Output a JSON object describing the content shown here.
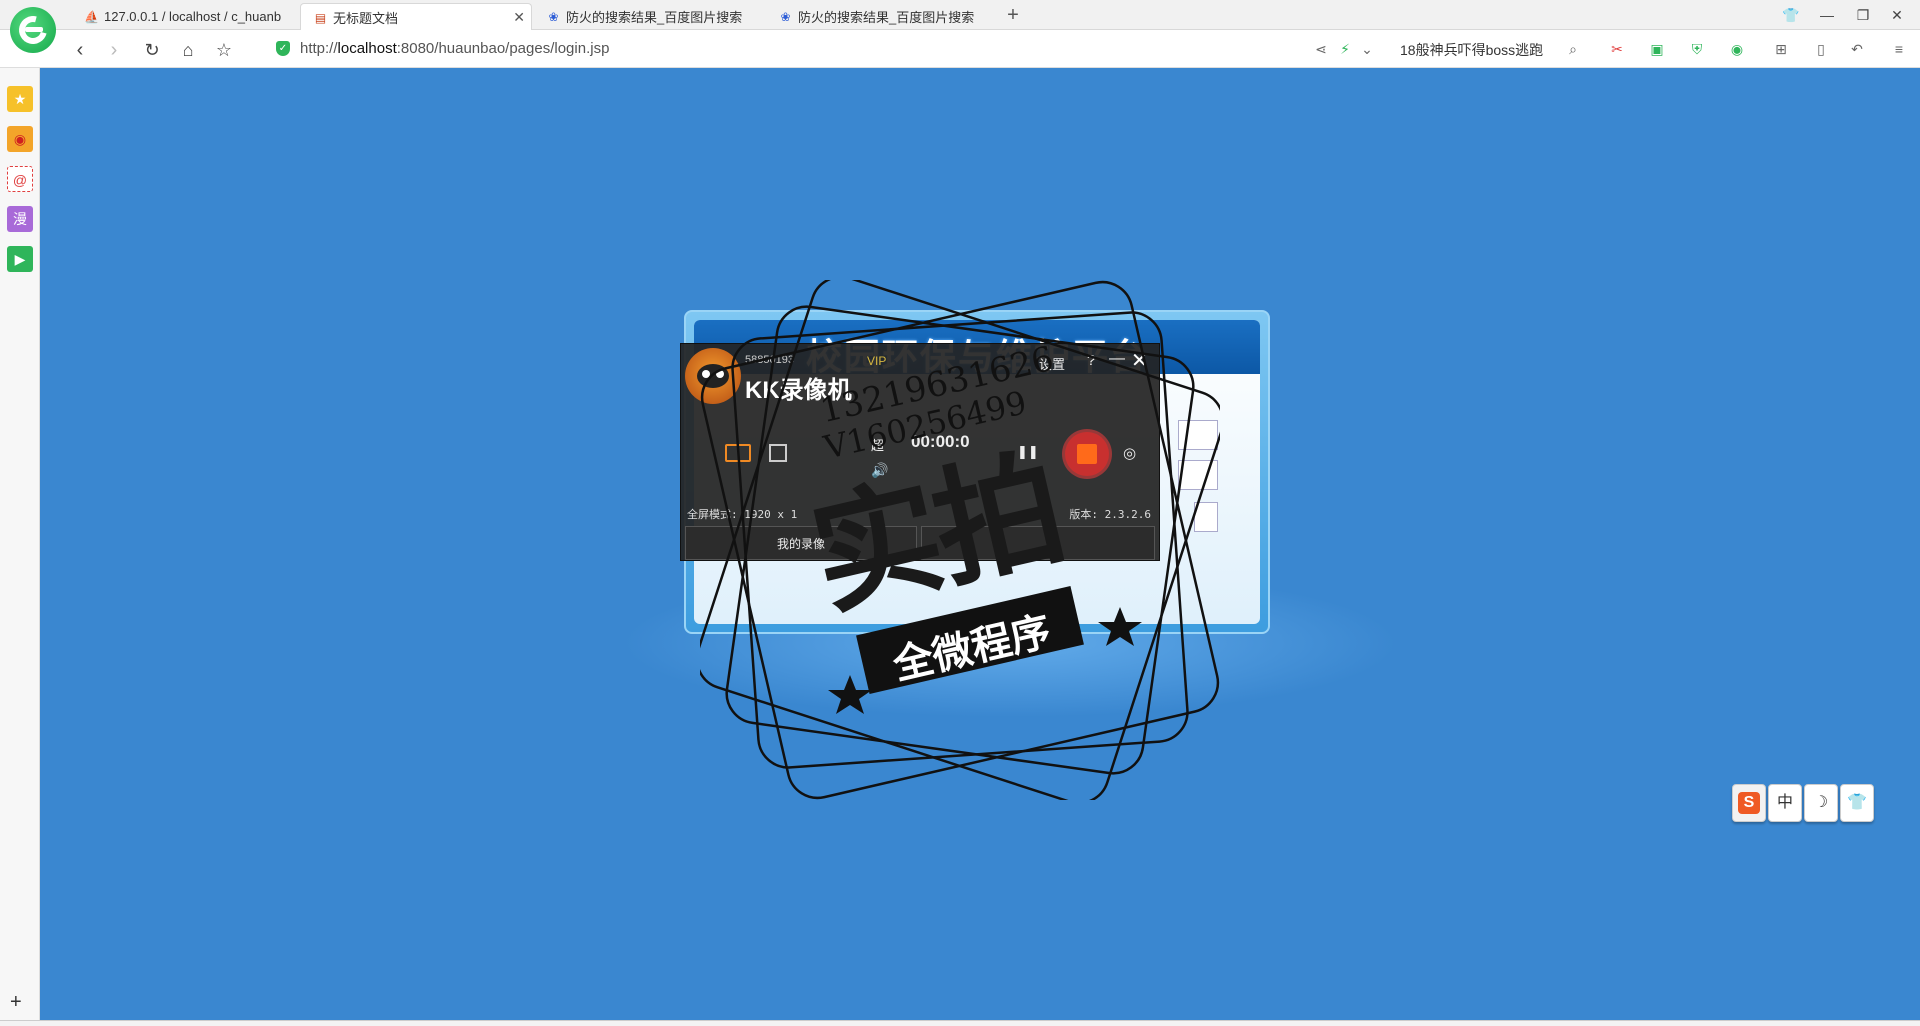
{
  "browser": {
    "tabs": [
      {
        "label": "127.0.0.1 / localhost / c_huanb",
        "icon": "phpmyadmin-icon",
        "active": false
      },
      {
        "label": "无标题文档",
        "icon": "document-icon",
        "active": true
      },
      {
        "label": "防火的搜索结果_百度图片搜索",
        "icon": "baidu-paw-icon",
        "active": false
      },
      {
        "label": "防火的搜索结果_百度图片搜索",
        "icon": "baidu-paw-icon",
        "active": false
      }
    ],
    "url_prefix": "http://",
    "url_host": "localhost",
    "url_rest": ":8080/huaunbao/pages/login.jsp",
    "search_text": "18般神兵吓得boss逃跑"
  },
  "login": {
    "title": "校园环保与维护平台"
  },
  "recorder": {
    "title": "KK录像机",
    "user_id": "58850193",
    "vip": "VIP",
    "settings": "设置",
    "help": "?",
    "label_super": "超",
    "timer": "00:00:0",
    "mode": "全屏模式: 1920 x 1",
    "version": "版本: 2.3.2.6",
    "my_recordings": "我的录像"
  },
  "watermark": {
    "phone1": "13219631626",
    "phone2": "V160256499",
    "big_text": "实拍",
    "banner": "全微程序"
  },
  "ime": {
    "logo": "S",
    "lang": "中",
    "moon": "☽",
    "skin": "👕"
  },
  "colors": {
    "page_bg": "#3a87d0",
    "title_bar": "#0c58a6",
    "record_button": "#c8302f"
  }
}
